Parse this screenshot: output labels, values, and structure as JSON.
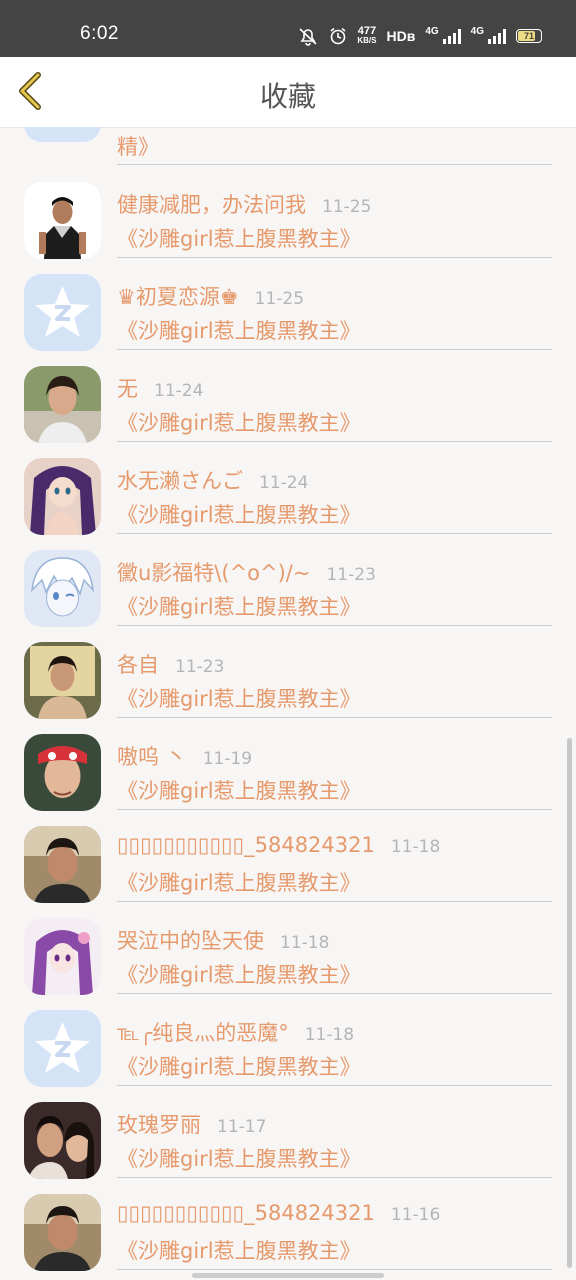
{
  "status": {
    "time": "6:02",
    "speed_value": "477",
    "speed_unit": "KB/S",
    "hd": "HDʙ",
    "net1": "4G",
    "net2": "4G",
    "battery": "71"
  },
  "header": {
    "title": "收藏"
  },
  "partial": {
    "book_tail": "精》"
  },
  "items": [
    {
      "name": "健康减肥，办法问我",
      "date": "11-25",
      "book": "《沙雕girl惹上腹黑教主》",
      "avatar_icon": "man-sports-avatar"
    },
    {
      "name": "♛初夏恋源♚",
      "date": "11-25",
      "book": "《沙雕girl惹上腹黑教主》",
      "avatar_icon": "qq-default-avatar"
    },
    {
      "name": "无",
      "date": "11-24",
      "book": "《沙雕girl惹上腹黑教主》",
      "avatar_icon": "girl-photo-avatar"
    },
    {
      "name": "水无濑さんご",
      "date": "11-24",
      "book": "《沙雕girl惹上腹黑教主》",
      "avatar_icon": "anime-girl-avatar"
    },
    {
      "name": "黴u影福特\\(^o^)/~",
      "date": "11-23",
      "book": "《沙雕girl惹上腹黑教主》",
      "avatar_icon": "anime-boy-avatar"
    },
    {
      "name": "各自",
      "date": "11-23",
      "book": "《沙雕girl惹上腹黑教主》",
      "avatar_icon": "woman-photo-avatar"
    },
    {
      "name": "嗷呜 丶",
      "date": "11-19",
      "book": "《沙雕girl惹上腹黑教主》",
      "avatar_icon": "man-eyemask-avatar"
    },
    {
      "name": "▯▯▯▯▯▯▯▯▯▯▯_584824321",
      "date": "11-18",
      "book": "《沙雕girl惹上腹黑教主》",
      "avatar_icon": "man-selfie-avatar"
    },
    {
      "name": "哭泣中的坠天使",
      "date": "11-18",
      "book": "《沙雕girl惹上腹黑教主》",
      "avatar_icon": "anime-purple-avatar"
    },
    {
      "name": "℡╭纯良灬的恶魔°",
      "date": "11-18",
      "book": "《沙雕girl惹上腹黑教主》",
      "avatar_icon": "qq-default-avatar"
    },
    {
      "name": "玫瑰罗丽",
      "date": "11-17",
      "book": "《沙雕girl惹上腹黑教主》",
      "avatar_icon": "couple-photo-avatar"
    },
    {
      "name": "▯▯▯▯▯▯▯▯▯▯▯_584824321",
      "date": "11-16",
      "book": "《沙雕girl惹上腹黑教主》",
      "avatar_icon": "man-selfie-avatar"
    }
  ]
}
